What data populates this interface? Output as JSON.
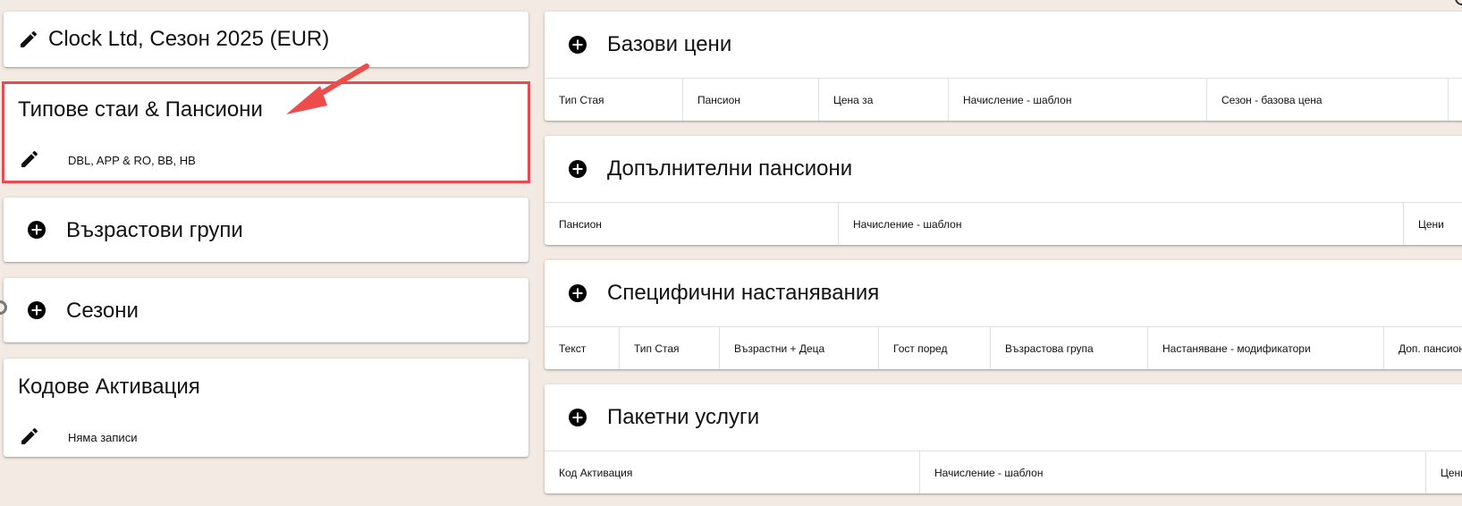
{
  "left": {
    "contract_title": "Clock Ltd, Сезон 2025 (EUR)",
    "room_types": {
      "title": "Типове стаи & Пансиони",
      "summary": "DBL, APP & RO, BB, HB"
    },
    "age_groups": {
      "title": "Възрастови групи"
    },
    "seasons": {
      "title": "Сезони"
    },
    "activation_codes": {
      "title": "Кодове Активация",
      "summary": "Няма записи"
    }
  },
  "right": {
    "base_prices": {
      "title": "Базови цени",
      "columns": [
        "Тип Стая",
        "Пансион",
        "Цена за",
        "Начисление - шаблон",
        "Сезон - базова цена"
      ]
    },
    "extra_boards": {
      "title": "Допълнителни пансиони",
      "columns": [
        "Пансион",
        "Начисление - шаблон",
        "Цени"
      ]
    },
    "specific_accommodations": {
      "title": "Специфични настанявания",
      "columns": [
        "Текст",
        "Тип Стая",
        "Възрастни + Деца",
        "Гост поред",
        "Възрастова група",
        "Настаняване - модификатори",
        "Доп. пансион"
      ]
    },
    "packages": {
      "title": "Пакетни услуги",
      "columns": [
        "Код Активация",
        "Начисление - шаблон",
        "Цени"
      ]
    }
  },
  "colors": {
    "background": "#f3ebe3",
    "highlight": "#e84a52",
    "arrow": "#ee4b4b"
  },
  "icons": [
    "pencil-icon",
    "plus-circle-icon"
  ]
}
